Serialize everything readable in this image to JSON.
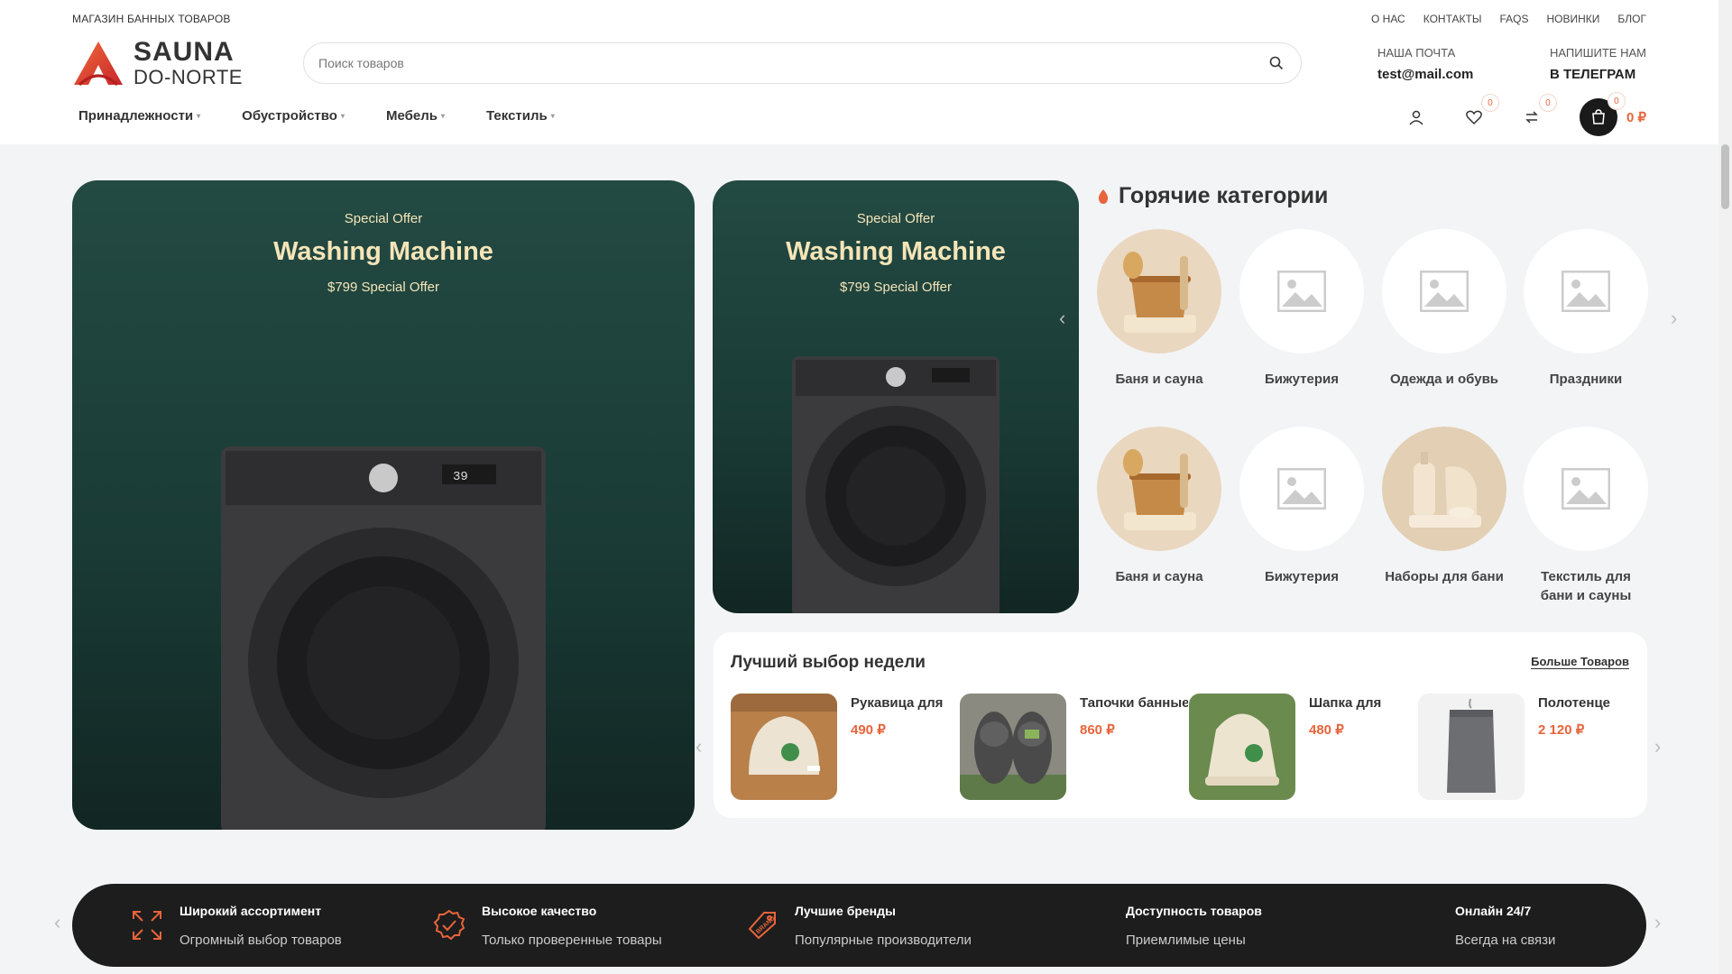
{
  "header": {
    "tagline": "МАГАЗИН БАННЫХ ТОВАРОВ",
    "top_links": [
      "О НАС",
      "КОНТАКТЫ",
      "FAQS",
      "НОВИНКИ",
      "БЛОГ"
    ],
    "logo": {
      "line1": "SAUNA",
      "line2": "DO-NORTE"
    },
    "search": {
      "placeholder": "Поиск товаров",
      "value": ""
    },
    "email": {
      "label": "НАША ПОЧТА",
      "value": "test@mail.com"
    },
    "telegram": {
      "label": "НАПИШИТЕ НАМ",
      "value": "В ТЕЛЕГРАМ"
    },
    "nav": [
      "Принадлежности",
      "Обустройство",
      "Мебель",
      "Текстиль"
    ],
    "wishlist_count": "0",
    "compare_count": "0",
    "cart_count": "0",
    "cart_total": "0 ₽"
  },
  "banners": [
    {
      "offer": "Special Offer",
      "title": "Washing Machine",
      "sub": "$799 Special Offer"
    },
    {
      "offer": "Special Offer",
      "title": "Washing Machine",
      "sub": "$799 Special Offer"
    }
  ],
  "hot_categories": {
    "title": "Горячие категории",
    "items": [
      "Баня и сауна",
      "Бижутерия",
      "Одежда и обувь",
      "Праздники",
      "Баня и сауна",
      "Бижутерия",
      "Наборы для бани",
      "Текстиль для бани и сауны"
    ]
  },
  "best_week": {
    "title": "Лучший выбор недели",
    "more": "Больше Товаров",
    "products": [
      {
        "name": "Рукавица для",
        "price": "490 ₽"
      },
      {
        "name": "Тапочки банные",
        "price": "860 ₽"
      },
      {
        "name": "Шапка для",
        "price": "480 ₽"
      },
      {
        "name": "Полотенце",
        "price": "2 120 ₽"
      }
    ]
  },
  "features": [
    {
      "title": "Широкий ассортимент",
      "desc": "Огромный выбор товаров"
    },
    {
      "title": "Высокое качество",
      "desc": "Только проверенные товары"
    },
    {
      "title": "Лучшие бренды",
      "desc": "Популярные производители"
    },
    {
      "title": "Доступность товаров",
      "desc": "Приемлимые цены"
    },
    {
      "title": "Онлайн 24/7",
      "desc": "Всегда на связи"
    }
  ],
  "colors": {
    "accent": "#e8643b",
    "banner": "#1f4540",
    "dark": "#1d1d1d"
  }
}
